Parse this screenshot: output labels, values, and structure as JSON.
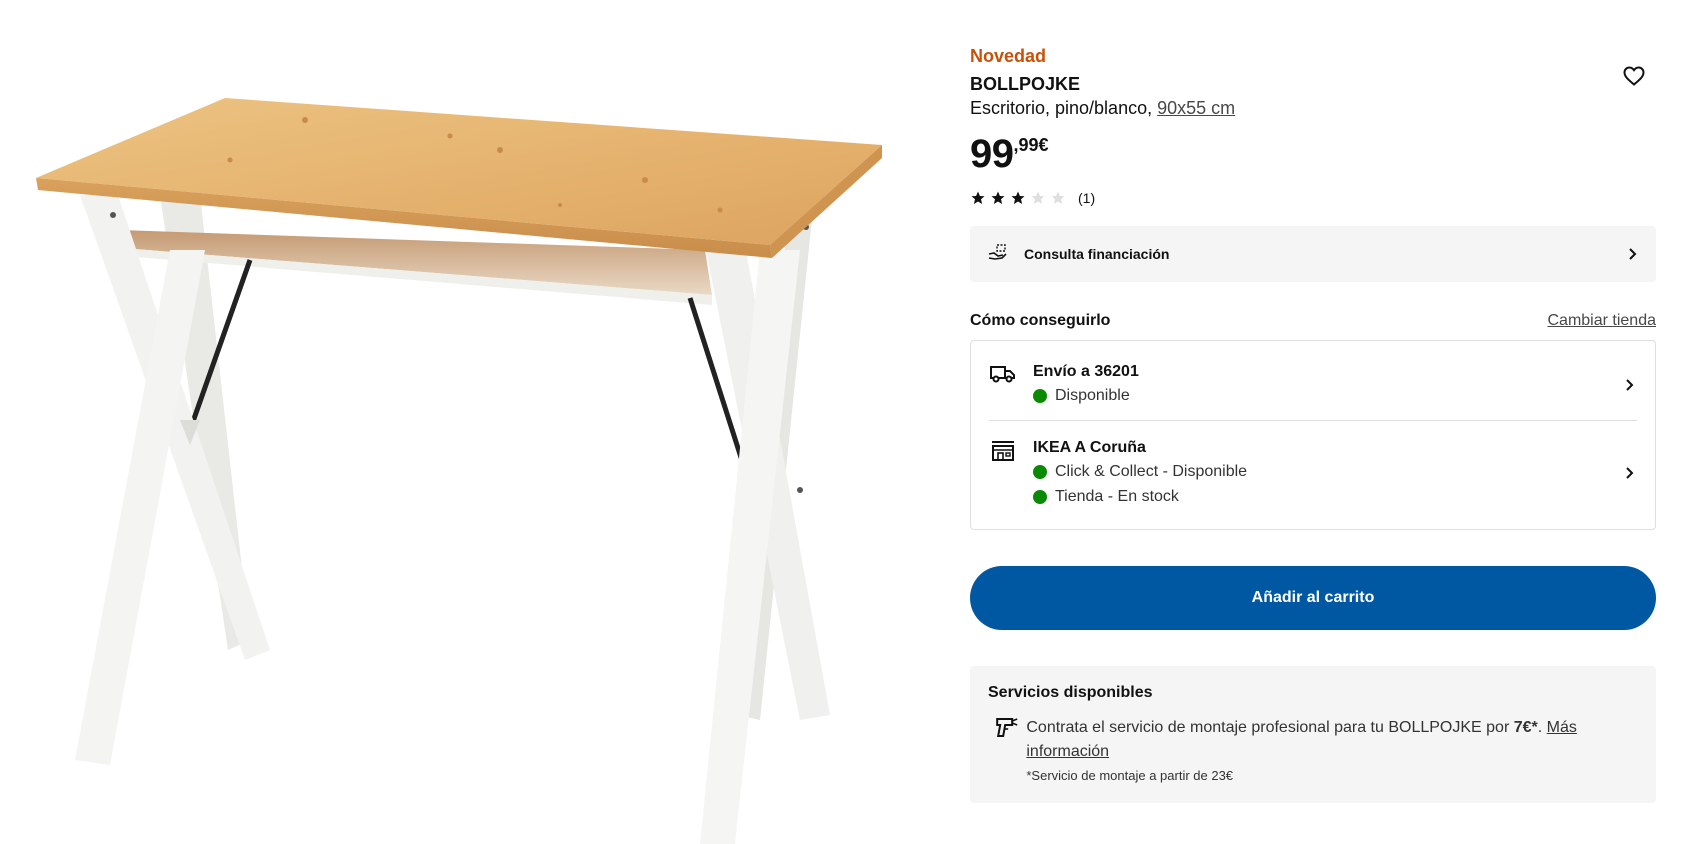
{
  "product": {
    "badge": "Novedad",
    "name": "BOLLPOJKE",
    "description": "Escritorio, pino/blanco,",
    "size_link": "90x55 cm",
    "price_integer": "99",
    "price_decimal": ",99€",
    "rating": {
      "stars": 3,
      "max_stars": 5,
      "count": "(1)"
    }
  },
  "finance": {
    "label": "Consulta financiación",
    "icon": "payment-hand-icon"
  },
  "how_to_get": {
    "title": "Cómo conseguirlo",
    "change_store": "Cambiar tienda",
    "delivery": {
      "title": "Envío a 36201",
      "status": "Disponible",
      "icon": "truck-icon"
    },
    "store": {
      "title": "IKEA A Coruña",
      "status_1": "Click & Collect - Disponible",
      "status_2": "Tienda - En stock",
      "icon": "store-icon"
    }
  },
  "cart": {
    "label": "Añadir al carrito"
  },
  "services": {
    "title": "Servicios disponibles",
    "text_before": "Contrata el servicio de montaje profesional para tu BOLLPOJKE por ",
    "price": "7€*",
    "text_after": ". ",
    "link": "Más información",
    "note": "*Servicio de montaje a partir de 23€",
    "icon": "assembly-drill-icon"
  },
  "colors": {
    "accent": "#0058a3",
    "badge": "#ca5008",
    "available": "#0a8a00",
    "panel_bg": "#f5f5f5"
  }
}
